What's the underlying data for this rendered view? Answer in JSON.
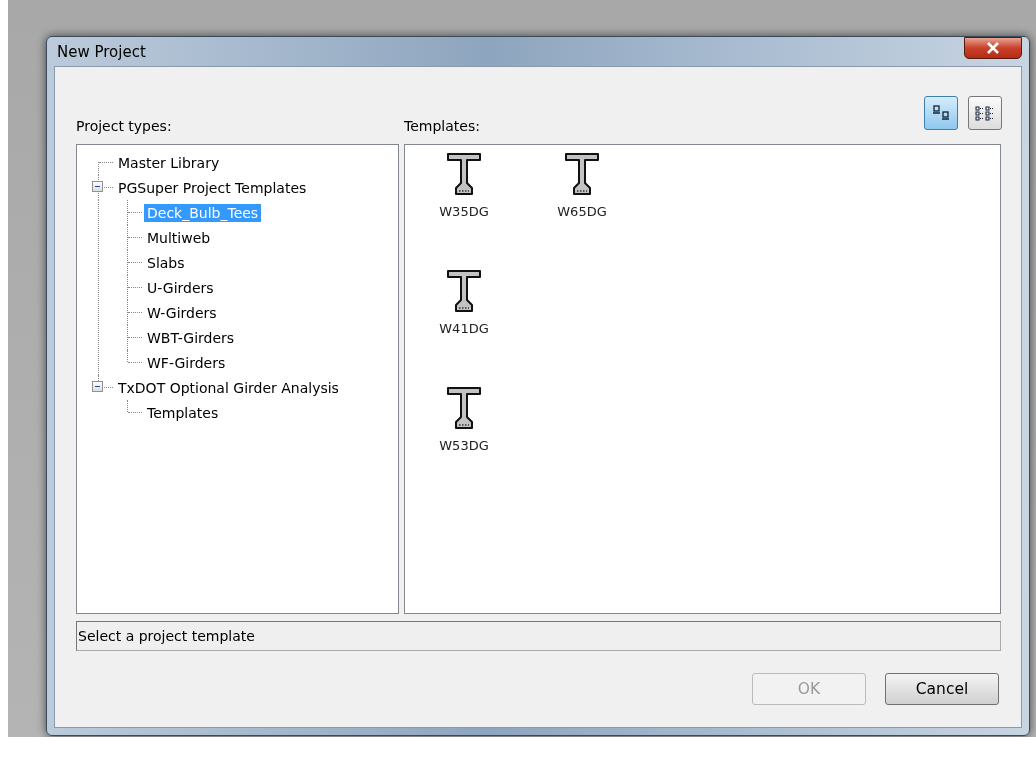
{
  "window": {
    "title": "New Project"
  },
  "view_buttons": [
    {
      "kind": "large-icons",
      "selected": true
    },
    {
      "kind": "list",
      "selected": false
    }
  ],
  "project_types": {
    "label": "Project types:",
    "items": [
      {
        "label": "Master Library",
        "selected": false
      },
      {
        "label": "PGSuper Project Templates",
        "selected": false,
        "expanded": true,
        "children": [
          {
            "label": "Deck_Bulb_Tees",
            "selected": true
          },
          {
            "label": "Multiweb",
            "selected": false
          },
          {
            "label": "Slabs",
            "selected": false
          },
          {
            "label": "U-Girders",
            "selected": false
          },
          {
            "label": "W-Girders",
            "selected": false
          },
          {
            "label": "WBT-Girders",
            "selected": false
          },
          {
            "label": "WF-Girders",
            "selected": false
          }
        ]
      },
      {
        "label": "TxDOT Optional Girder Analysis",
        "selected": false,
        "expanded": true,
        "children": [
          {
            "label": "Templates",
            "selected": false
          }
        ]
      }
    ]
  },
  "templates": {
    "label": "Templates:",
    "items": [
      {
        "label": "W35DG",
        "selected": false
      },
      {
        "label": "W41DG",
        "selected": false
      },
      {
        "label": "W53DG",
        "selected": false
      },
      {
        "label": "W65DG",
        "selected": false
      }
    ]
  },
  "status": "Select a project template",
  "buttons": [
    {
      "label": "OK",
      "disabled": true
    },
    {
      "label": "Cancel",
      "disabled": false
    }
  ]
}
